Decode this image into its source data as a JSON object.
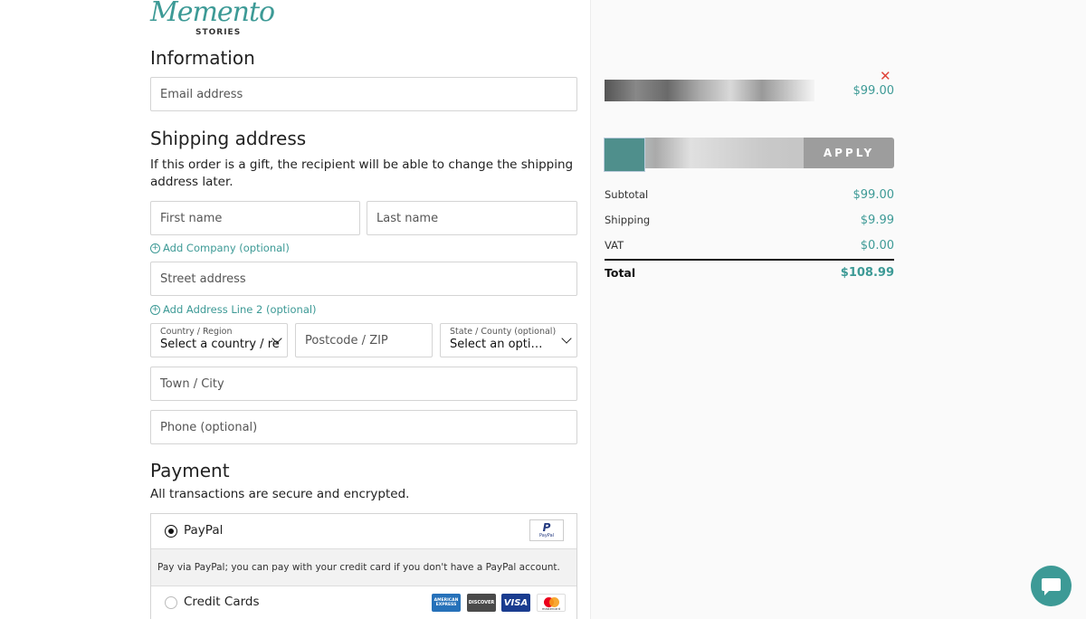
{
  "logo": {
    "script": "Memento",
    "sub": "STORIES"
  },
  "information": {
    "title": "Information",
    "email_placeholder": "Email address"
  },
  "shipping": {
    "title": "Shipping address",
    "note": "If this order is a gift, the recipient will be able to change the shipping address later.",
    "first_name_placeholder": "First name",
    "last_name_placeholder": "Last name",
    "add_company": "Add Company (optional)",
    "street_placeholder": "Street address",
    "add_address2": "Add Address Line 2 (optional)",
    "country_label": "Country / Region",
    "country_value": "Select a country / region…",
    "postcode_placeholder": "Postcode / ZIP",
    "state_label": "State / County (optional)",
    "state_value": "Select an option…",
    "town_placeholder": "Town / City",
    "phone_placeholder": "Phone (optional)"
  },
  "payment": {
    "title": "Payment",
    "note": "All transactions are secure and encrypted.",
    "paypal_label": "PayPal",
    "paypal_desc": "Pay via PayPal; you can pay with your credit card if you don't have a PayPal account.",
    "paypal_logo": "PayPal",
    "cards_label": "Credit Cards",
    "card_brands": [
      "AMERICAN EXPRESS",
      "DISCOVER",
      "VISA",
      "mastercard"
    ]
  },
  "order": {
    "item_price": "$99.00",
    "remove_icon": "close-icon",
    "apply_label": "APPLY",
    "subtotal_label": "Subtotal",
    "subtotal_value": "$99.00",
    "shipping_label": "Shipping",
    "shipping_value": "$9.99",
    "vat_label": "VAT",
    "vat_value": "$0.00",
    "total_label": "Total",
    "total_value": "$108.99"
  },
  "colors": {
    "accent": "#3d9a96",
    "remove": "#e0443a"
  },
  "chat_icon": "chat-bubble-icon"
}
